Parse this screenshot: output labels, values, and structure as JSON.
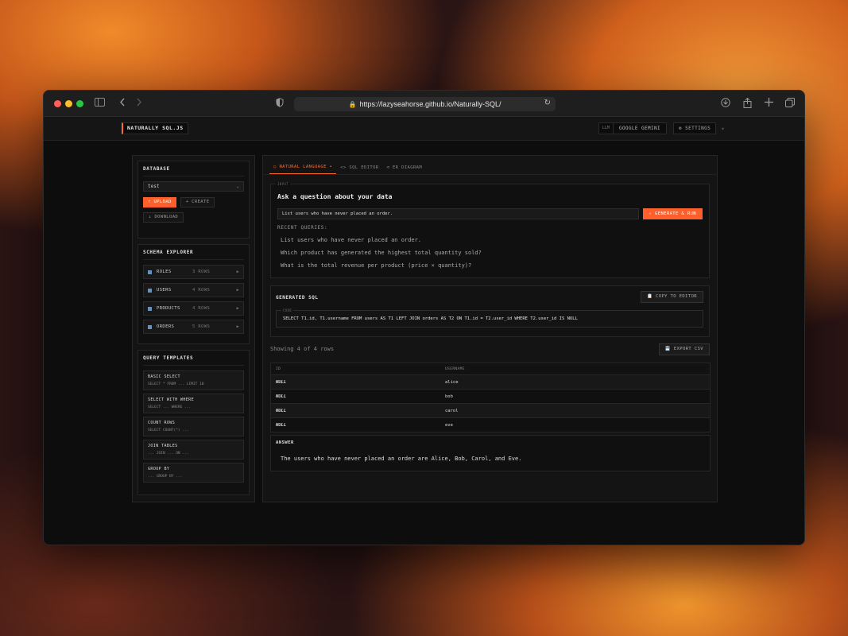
{
  "browser": {
    "url": "https://lazyseahorse.github.io/Naturally-SQL/"
  },
  "header": {
    "brand": "NATURALLY SQL.JS",
    "llm_tag": "LLM",
    "llm_model": "GOOGLE GEMINI",
    "settings": "SETTINGS"
  },
  "sidebar": {
    "database": {
      "title": "DATABASE",
      "selected": "test",
      "upload": "UPLOAD",
      "create": "CREATE",
      "download": "DOWNLOAD"
    },
    "schema": {
      "title": "SCHEMA EXPLORER",
      "tables": [
        {
          "name": "ROLES",
          "rows": "3 ROWS"
        },
        {
          "name": "USERS",
          "rows": "4 ROWS"
        },
        {
          "name": "PRODUCTS",
          "rows": "4 ROWS"
        },
        {
          "name": "ORDERS",
          "rows": "5 ROWS"
        }
      ]
    },
    "templates": {
      "title": "QUERY TEMPLATES",
      "items": [
        {
          "name": "BASIC SELECT",
          "code": "SELECT * FROM ... LIMIT 10"
        },
        {
          "name": "SELECT WITH WHERE",
          "code": "SELECT ... WHERE ..."
        },
        {
          "name": "COUNT ROWS",
          "code": "SELECT COUNT(*) ..."
        },
        {
          "name": "JOIN TABLES",
          "code": "... JOIN ... ON ..."
        },
        {
          "name": "GROUP BY",
          "code": "... GROUP BY ..."
        }
      ]
    }
  },
  "main": {
    "tabs": [
      {
        "label": "NATURAL LANGUAGE"
      },
      {
        "label": "SQL EDITOR"
      },
      {
        "label": "ER DIAGRAM"
      }
    ],
    "input": {
      "label": "INPUT",
      "title": "Ask a question about your data",
      "query": "List users who have never placed an order.",
      "generate": "GENERATE & RUN",
      "recent_label": "RECENT QUERIES:",
      "recent": [
        "List users who have never placed an order.",
        "Which product has generated the highest total quantity sold?",
        "What is the total revenue per product (price × quantity)?"
      ]
    },
    "generated": {
      "title": "GENERATED SQL",
      "copy": "COPY TO EDITOR",
      "code_label": "CODE",
      "sql": "SELECT T1.id, T1.username FROM users AS T1 LEFT JOIN orders AS T2 ON T1.id = T2.user_id WHERE T2.user_id IS NULL"
    },
    "results": {
      "showing": "Showing 4 of 4 rows",
      "export": "EXPORT CSV",
      "columns": [
        "ID",
        "USERNAME"
      ],
      "rows": [
        [
          "NULL",
          "alice"
        ],
        [
          "NULL",
          "bob"
        ],
        [
          "NULL",
          "carol"
        ],
        [
          "NULL",
          "eve"
        ]
      ]
    },
    "answer": {
      "title": "ANSWER",
      "text": "The users who have never placed an order are Alice, Bob, Carol, and Eve."
    }
  },
  "colors": {
    "accent": "#ff5f2a",
    "background": "#0d0d0d"
  }
}
